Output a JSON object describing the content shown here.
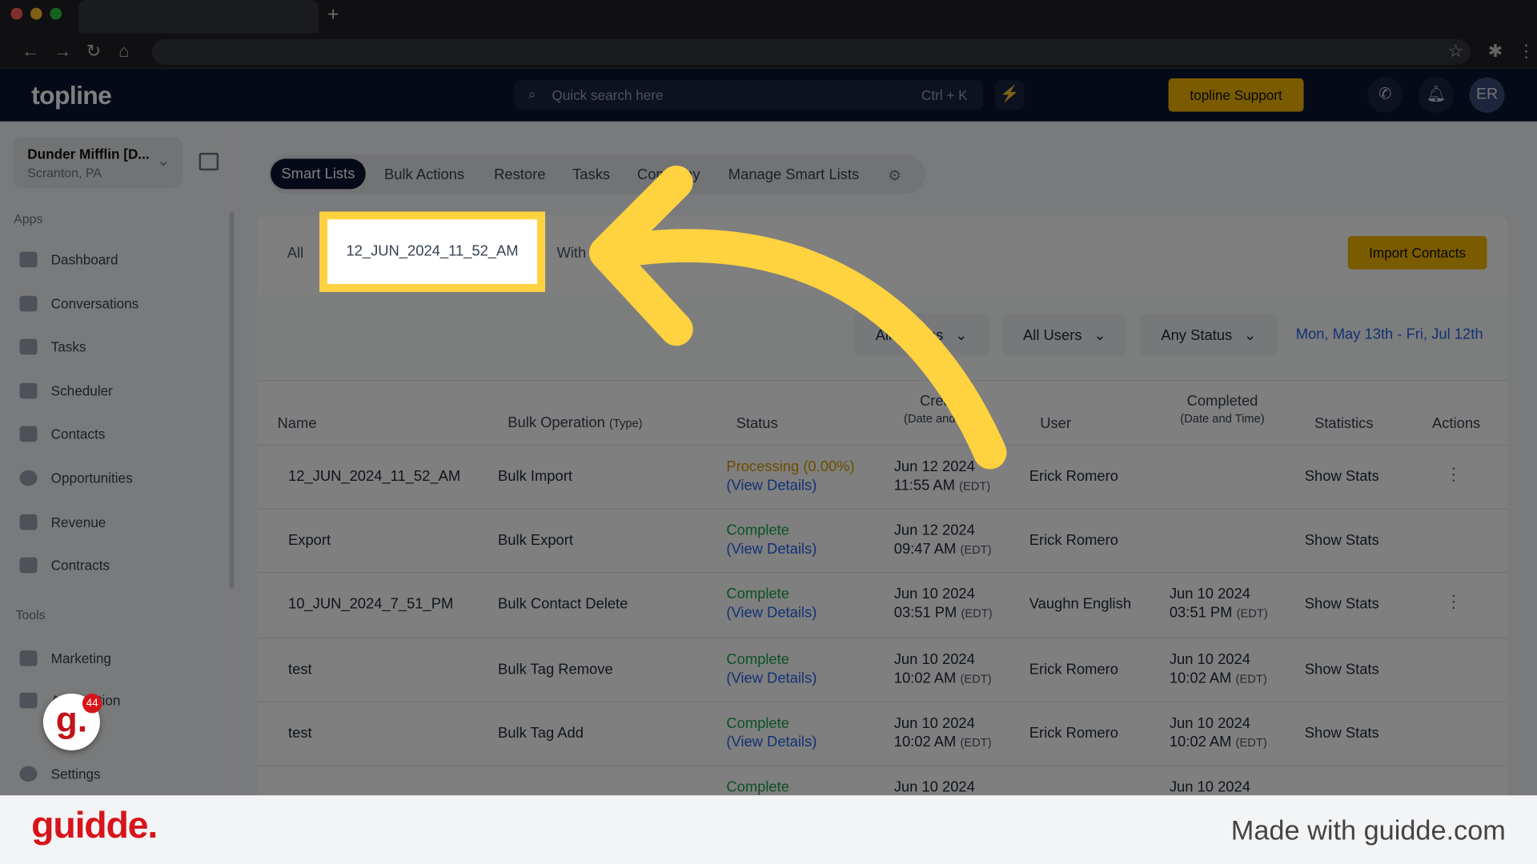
{
  "browser": {
    "new_tab": "+"
  },
  "app": {
    "logo": "topline",
    "search_placeholder": "Quick search here",
    "search_shortcut": "Ctrl + K",
    "support_label": "topline Support",
    "avatar_initials": "ER"
  },
  "sidebar": {
    "org_name": "Dunder Mifflin [D...",
    "org_location": "Scranton, PA",
    "apps_label": "Apps",
    "apps": [
      "Dashboard",
      "Conversations",
      "Tasks",
      "Scheduler",
      "Contacts",
      "Opportunities",
      "Revenue",
      "Contracts"
    ],
    "tools_label": "Tools",
    "tools": [
      "Marketing",
      "Automation"
    ],
    "settings_label": "Settings"
  },
  "tabs": [
    "Smart Lists",
    "Bulk Actions",
    "Restore",
    "Tasks",
    "Company",
    "Manage Smart Lists"
  ],
  "subtabs": {
    "all": "All",
    "selected": "12_JUN_2024_11_52_AM",
    "with": "With"
  },
  "import_label": "Import Contacts",
  "filters": {
    "actions": "All Actions",
    "users": "All Users",
    "status": "Any Status",
    "date_range": "Mon, May 13th - Fri, Jul 12th"
  },
  "table": {
    "headers": {
      "name": "Name",
      "op": "Bulk Operation",
      "op_sub": "(Type)",
      "status": "Status",
      "created": "Created",
      "created_sub": "(Date and Time)",
      "user": "User",
      "completed": "Completed",
      "completed_sub": "(Date and Time)",
      "stats": "Statistics",
      "actions": "Actions"
    },
    "view_details": "(View Details)",
    "show_stats": "Show Stats",
    "tz": "(EDT)",
    "rows": [
      {
        "name": "12_JUN_2024_11_52_AM",
        "op": "Bulk Import",
        "status": "Processing (0.00%)",
        "created_date": "Jun 12 2024",
        "created_time": "11:55 AM",
        "user": "Erick Romero",
        "completed_date": "",
        "completed_time": ""
      },
      {
        "name": "Export",
        "op": "Bulk Export",
        "status": "Complete",
        "created_date": "Jun 12 2024",
        "created_time": "09:47 AM",
        "user": "Erick Romero",
        "completed_date": "",
        "completed_time": ""
      },
      {
        "name": "10_JUN_2024_7_51_PM",
        "op": "Bulk Contact Delete",
        "status": "Complete",
        "created_date": "Jun 10 2024",
        "created_time": "03:51 PM",
        "user": "Vaughn English",
        "completed_date": "Jun 10 2024",
        "completed_time": "03:51 PM"
      },
      {
        "name": "test",
        "op": "Bulk Tag Remove",
        "status": "Complete",
        "created_date": "Jun 10 2024",
        "created_time": "10:02 AM",
        "user": "Erick Romero",
        "completed_date": "Jun 10 2024",
        "completed_time": "10:02 AM"
      },
      {
        "name": "test",
        "op": "Bulk Tag Add",
        "status": "Complete",
        "created_date": "Jun 10 2024",
        "created_time": "10:02 AM",
        "user": "Erick Romero",
        "completed_date": "Jun 10 2024",
        "completed_time": "10:02 AM"
      },
      {
        "name": "",
        "op": "",
        "status": "Complete",
        "created_date": "Jun 10 2024",
        "created_time": "",
        "user": "",
        "completed_date": "Jun 10 2024",
        "completed_time": ""
      }
    ]
  },
  "footer": {
    "logo": "guidde.",
    "made_with": "Made with guidde.com",
    "badge_count": "44"
  },
  "colors": {
    "accent": "#f5b700",
    "highlight": "#ffd23f",
    "navy": "#0b1430",
    "processing": "#d49b00",
    "complete": "#16a34a",
    "link": "#2563eb"
  }
}
